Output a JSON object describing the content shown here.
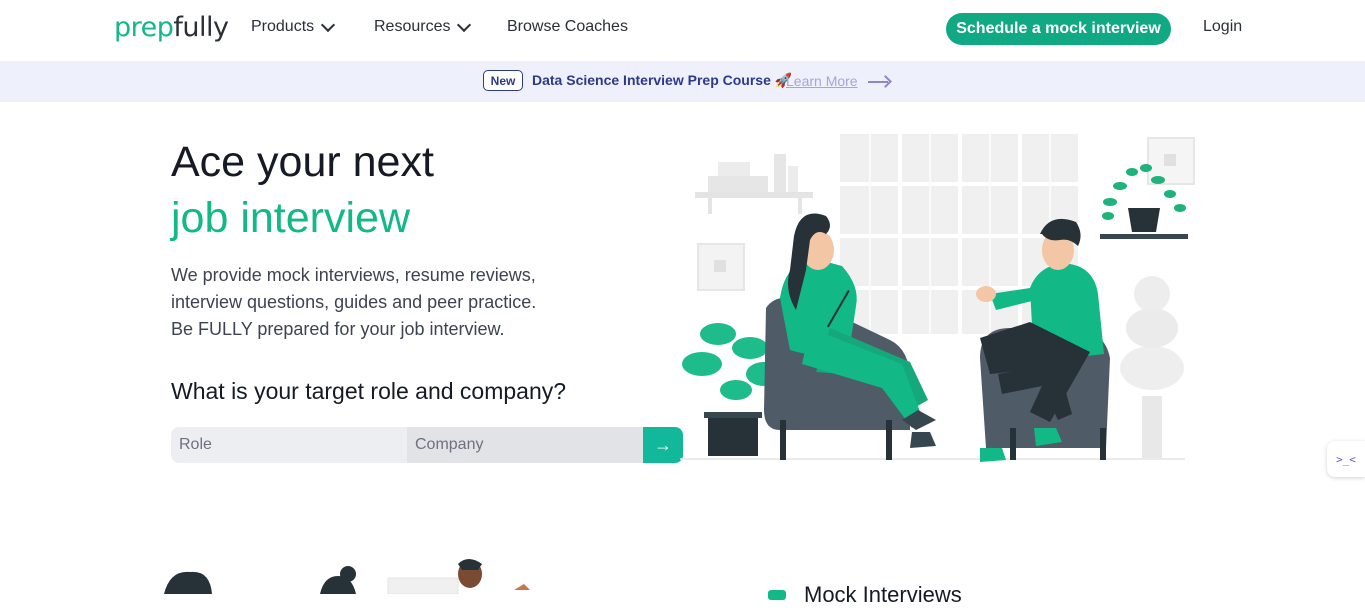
{
  "nav": {
    "logo_part1": "prep",
    "logo_part2": "fully",
    "products": "Products",
    "resources": "Resources",
    "browse_coaches": "Browse Coaches",
    "cta": "Schedule a mock interview",
    "login": "Login"
  },
  "banner": {
    "badge": "New",
    "text": "Data Science Interview Prep Course 🚀",
    "link": "Learn More"
  },
  "hero": {
    "title_line1": "Ace your next",
    "title_line2": "job interview",
    "desc_line1": "We provide mock interviews, resume reviews,",
    "desc_line2": "interview questions, guides and peer practice.",
    "desc_line3": "Be FULLY prepared for your job interview.",
    "question": "What is your target role and company?",
    "role_placeholder": "Role",
    "company_placeholder": "Company",
    "submit_arrow": "→"
  },
  "side_widget": {
    "glyph": ">_<"
  },
  "below": {
    "mock_label": "Mock Interviews"
  },
  "colors": {
    "brand": "#12b886",
    "banner_bg": "#eef0fb",
    "banner_text": "#2d3a8c"
  }
}
